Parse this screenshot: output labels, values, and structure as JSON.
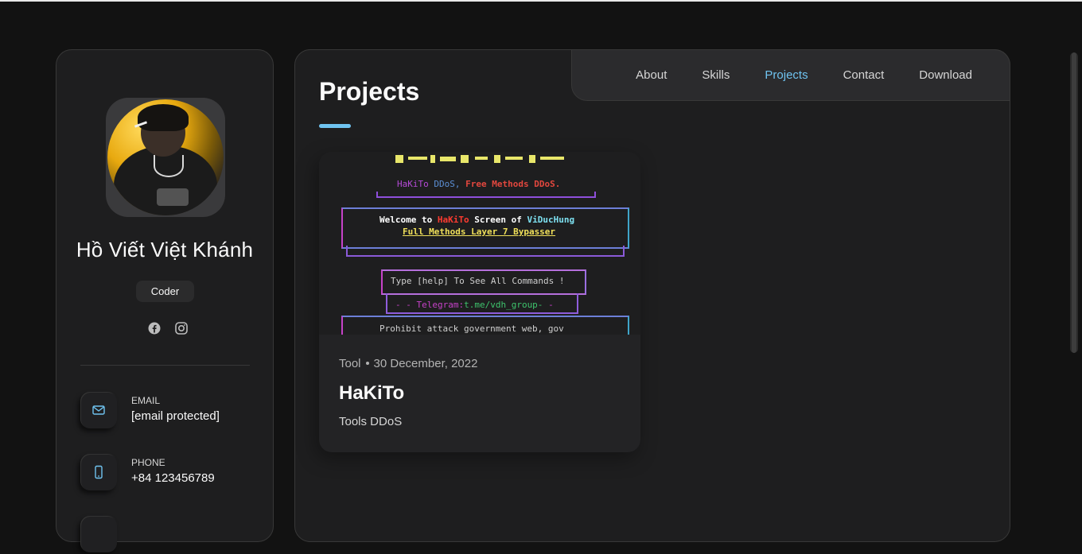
{
  "profile": {
    "name": "Hồ Viết Việt Khánh",
    "role": "Coder",
    "socials": [
      "facebook-icon",
      "instagram-icon"
    ]
  },
  "contacts": [
    {
      "title": "Email",
      "value": "[email protected]",
      "icon": "mail-icon"
    },
    {
      "title": "Phone",
      "value": "+84 123456789",
      "icon": "phone-icon"
    }
  ],
  "nav": {
    "items": [
      "About",
      "Skills",
      "Projects",
      "Contact",
      "Download"
    ],
    "active": "Projects"
  },
  "page": {
    "title": "Projects"
  },
  "project": {
    "category": "Tool",
    "date": "30 December, 2022",
    "title": "HaKiTo",
    "description": "Tools DDoS",
    "image": {
      "line1_a": "HaKiTo",
      "line1_b": "DDoS,",
      "line1_c": "Free Methods DDoS.",
      "welcome_a": "Welcome to",
      "welcome_b": "HaKiTo",
      "welcome_c": "Screen of",
      "welcome_d": "ViDucHung",
      "bypass": "Full Methods Layer 7 Bypasser",
      "help": "Type [help] To See All Commands !",
      "telegram_a": "- - Telegram:",
      "telegram_b": "t.me/vdh_group-",
      "telegram_c": "-",
      "prohibit": "Prohibit attack government web, gov"
    }
  },
  "colors": {
    "accent": "#6fc3f0",
    "card_bg": "#232325",
    "page_bg": "#121212"
  }
}
